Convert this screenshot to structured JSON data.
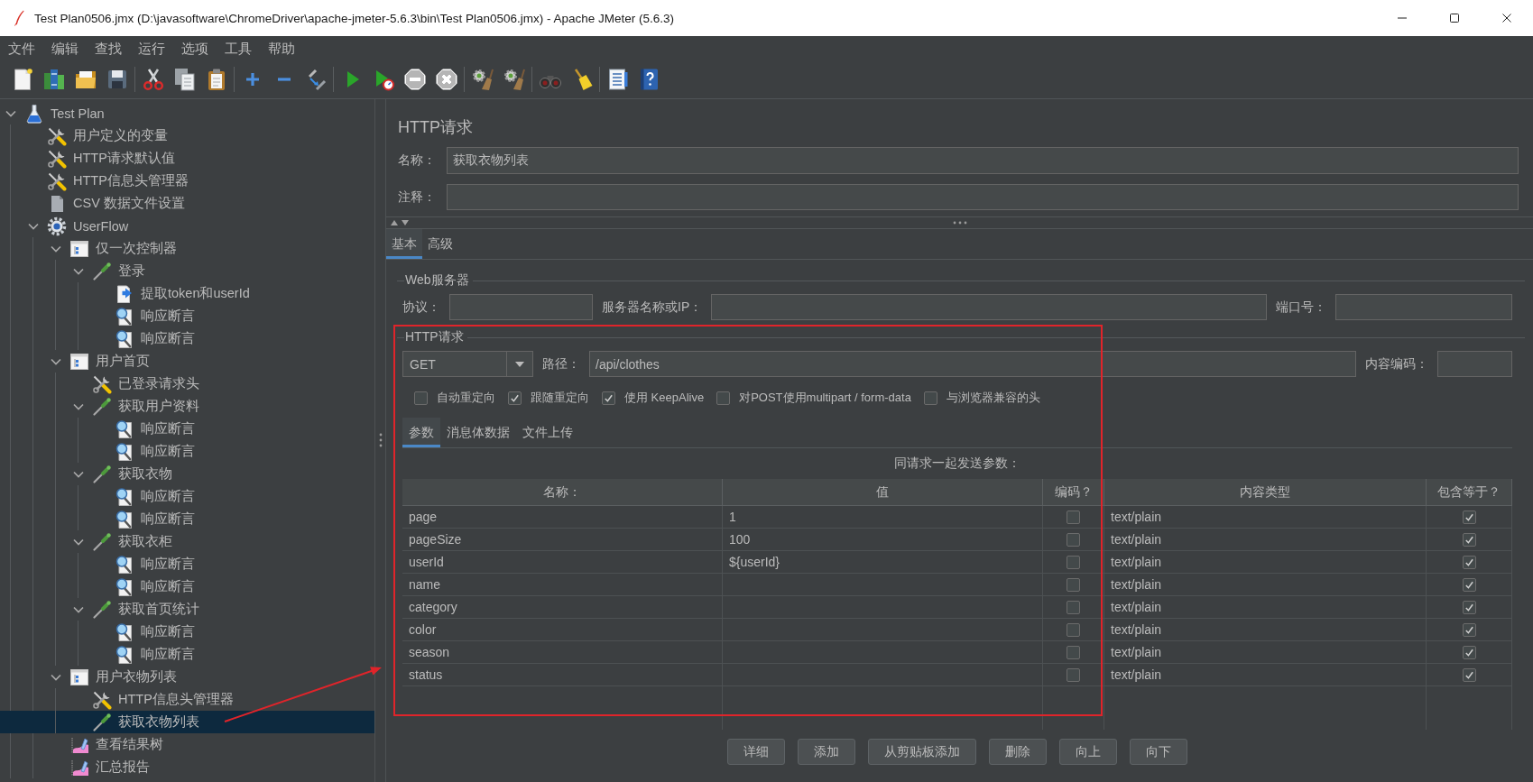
{
  "window": {
    "title": "Test Plan0506.jmx (D:\\javasoftware\\ChromeDriver\\apache-jmeter-5.6.3\\bin\\Test Plan0506.jmx) - Apache JMeter (5.6.3)"
  },
  "menu": [
    "文件",
    "编辑",
    "查找",
    "运行",
    "选项",
    "工具",
    "帮助"
  ],
  "toolbar": [
    [
      {
        "disabled": false
      },
      {
        "disabled": false
      },
      {
        "disabled": false
      },
      {
        "disabled": false
      }
    ],
    [
      {
        "disabled": false
      },
      {
        "disabled": false
      },
      {
        "disabled": false
      }
    ],
    [
      {
        "disabled": false
      },
      {
        "disabled": false
      },
      {
        "disabled": false
      }
    ],
    [
      {
        "disabled": false
      },
      {
        "disabled": false
      },
      {
        "disabled": true
      },
      {
        "disabled": true
      }
    ],
    [
      {
        "disabled": false
      },
      {
        "disabled": false
      }
    ],
    [
      {
        "disabled": false
      },
      {
        "disabled": false
      }
    ],
    [
      {
        "disabled": false
      },
      {
        "disabled": false
      }
    ]
  ],
  "tree": [
    {
      "label": "Test Plan",
      "kind": "plan",
      "expanded": true,
      "selected": false,
      "children": [
        {
          "label": "用户定义的变量",
          "kind": "config",
          "selected": false
        },
        {
          "label": "HTTP请求默认值",
          "kind": "config",
          "selected": false
        },
        {
          "label": "HTTP信息头管理器",
          "kind": "config",
          "selected": false
        },
        {
          "label": "CSV 数据文件设置",
          "kind": "data-source",
          "selected": false
        },
        {
          "label": "UserFlow",
          "kind": "thread-group",
          "expanded": true,
          "selected": false,
          "children": [
            {
              "label": "仅一次控制器",
              "kind": "controller",
              "expanded": true,
              "selected": false,
              "children": [
                {
                  "label": "登录",
                  "kind": "sampler",
                  "expanded": true,
                  "selected": false,
                  "children": [
                    {
                      "label": "提取token和userId",
                      "kind": "extractor",
                      "selected": false
                    },
                    {
                      "label": "响应断言",
                      "kind": "assertion",
                      "selected": false
                    },
                    {
                      "label": "响应断言",
                      "kind": "assertion",
                      "selected": false
                    }
                  ]
                }
              ]
            },
            {
              "label": "用户首页",
              "kind": "controller",
              "expanded": true,
              "selected": false,
              "children": [
                {
                  "label": "已登录请求头",
                  "kind": "config",
                  "selected": false
                },
                {
                  "label": "获取用户资料",
                  "kind": "sampler",
                  "expanded": true,
                  "selected": false,
                  "children": [
                    {
                      "label": "响应断言",
                      "kind": "assertion",
                      "selected": false
                    },
                    {
                      "label": "响应断言",
                      "kind": "assertion",
                      "selected": false
                    }
                  ]
                },
                {
                  "label": "获取衣物",
                  "kind": "sampler",
                  "expanded": true,
                  "selected": false,
                  "children": [
                    {
                      "label": "响应断言",
                      "kind": "assertion",
                      "selected": false
                    },
                    {
                      "label": "响应断言",
                      "kind": "assertion",
                      "selected": false
                    }
                  ]
                },
                {
                  "label": "获取衣柜",
                  "kind": "sampler",
                  "expanded": true,
                  "selected": false,
                  "children": [
                    {
                      "label": "响应断言",
                      "kind": "assertion",
                      "selected": false
                    },
                    {
                      "label": "响应断言",
                      "kind": "assertion",
                      "selected": false
                    }
                  ]
                },
                {
                  "label": "获取首页统计",
                  "kind": "sampler",
                  "expanded": true,
                  "selected": false,
                  "children": [
                    {
                      "label": "响应断言",
                      "kind": "assertion",
                      "selected": false
                    },
                    {
                      "label": "响应断言",
                      "kind": "assertion",
                      "selected": false
                    }
                  ]
                }
              ]
            },
            {
              "label": "用户衣物列表",
              "kind": "controller",
              "expanded": true,
              "selected": false,
              "children": [
                {
                  "label": "HTTP信息头管理器",
                  "kind": "config",
                  "selected": false
                },
                {
                  "label": "获取衣物列表",
                  "kind": "sampler",
                  "selected": true
                }
              ]
            },
            {
              "label": "查看结果树",
              "kind": "listener",
              "selected": false
            },
            {
              "label": "汇总报告",
              "kind": "listener",
              "selected": false
            }
          ]
        }
      ]
    }
  ],
  "editor": {
    "title": "HTTP请求",
    "name": {
      "label": "名称：",
      "value": "获取衣物列表"
    },
    "comment": {
      "label": "注释："
    },
    "tabs": [
      {
        "label": "基本",
        "selected": true
      },
      {
        "label": "高级",
        "selected": false
      }
    ],
    "web_server": {
      "title": "Web服务器",
      "fields": [
        {
          "label": "协议："
        },
        {
          "label": "服务器名称或IP："
        },
        {
          "label": "端口号："
        }
      ]
    },
    "http_request": {
      "title": "HTTP请求",
      "method": "GET",
      "path": {
        "label": "路径：",
        "value": "/api/clothes"
      },
      "encoding": {
        "label": "内容编码："
      },
      "options": [
        {
          "label": "自动重定向",
          "checked": false
        },
        {
          "label": "跟随重定向",
          "checked": true
        },
        {
          "label": "使用 KeepAlive",
          "checked": true
        },
        {
          "label": "对POST使用multipart / form-data",
          "checked": false
        },
        {
          "label": "与浏览器兼容的头",
          "checked": false
        }
      ],
      "tabs": [
        {
          "label": "参数",
          "selected": true
        },
        {
          "label": "消息体数据",
          "selected": false
        },
        {
          "label": "文件上传",
          "selected": false
        }
      ],
      "caption": "同请求一起发送参数：",
      "table": {
        "columns": [
          "名称：",
          "值",
          "编码？",
          "内容类型",
          "包含等于？"
        ],
        "rows": [
          {
            "name": "page",
            "value": "1",
            "encode": false,
            "content_type": "text/plain",
            "include_equals": true
          },
          {
            "name": "pageSize",
            "value": "100",
            "encode": false,
            "content_type": "text/plain",
            "include_equals": true
          },
          {
            "name": "userId",
            "value": "${userId}",
            "encode": false,
            "content_type": "text/plain",
            "include_equals": true
          },
          {
            "name": "name",
            "encode": false,
            "content_type": "text/plain",
            "include_equals": true
          },
          {
            "name": "category",
            "encode": false,
            "content_type": "text/plain",
            "include_equals": true
          },
          {
            "name": "color",
            "encode": false,
            "content_type": "text/plain",
            "include_equals": true
          },
          {
            "name": "season",
            "encode": false,
            "content_type": "text/plain",
            "include_equals": true
          },
          {
            "name": "status",
            "encode": false,
            "content_type": "text/plain",
            "include_equals": true
          }
        ]
      }
    },
    "buttons": [
      "详细",
      "添加",
      "从剪贴板添加",
      "删除",
      "向上",
      "向下"
    ]
  }
}
